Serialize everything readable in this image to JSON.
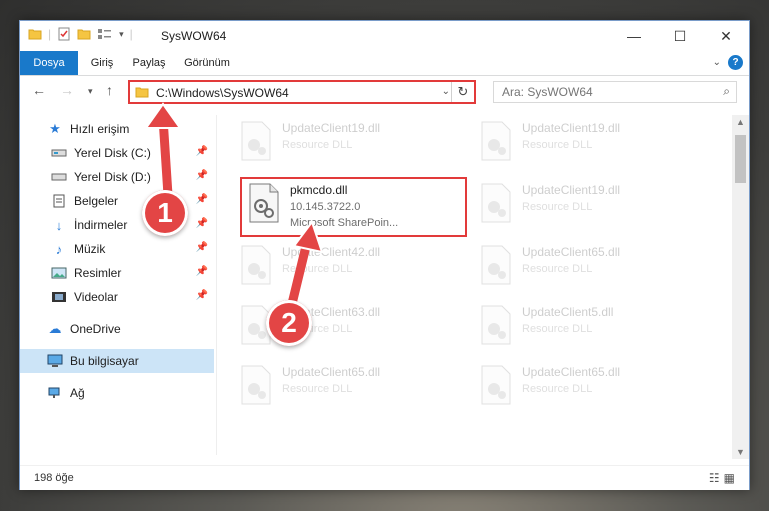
{
  "window": {
    "title": "SysWOW64",
    "controls": {
      "minimize": "—",
      "maximize": "☐",
      "close": "✕"
    }
  },
  "ribbon": {
    "tabs": [
      {
        "label": "Dosya"
      },
      {
        "label": "Giriş"
      },
      {
        "label": "Paylaş"
      },
      {
        "label": "Görünüm"
      }
    ],
    "help": "?"
  },
  "nav": {
    "address_path": "C:\\Windows\\SysWOW64",
    "search_placeholder": "Ara: SysWOW64"
  },
  "sidebar": {
    "quick_access": "Hızlı erişim",
    "items": [
      {
        "label": "Yerel Disk (C:)"
      },
      {
        "label": "Yerel Disk (D:)"
      },
      {
        "label": "Belgeler"
      },
      {
        "label": "İndirmeler"
      },
      {
        "label": "Müzik"
      },
      {
        "label": "Resimler"
      },
      {
        "label": "Videolar"
      }
    ],
    "onedrive": "OneDrive",
    "this_pc": "Bu bilgisayar",
    "network": "Ağ"
  },
  "files": {
    "highlighted": {
      "name": "pkmcdo.dll",
      "version": "10.145.3722.0",
      "description": "Microsoft SharePoin..."
    },
    "background": [
      {
        "name": "UpdateClient19.dll",
        "desc": "Resource DLL"
      },
      {
        "name": "UpdateClient19.dll",
        "desc": "Resource DLL"
      },
      {
        "name": "UpdateClient19.dll",
        "desc": "Resource DLL"
      },
      {
        "name": "UpdateClient42.dll",
        "desc": "Resource DLL"
      },
      {
        "name": "UpdateClient65.dll",
        "desc": "Resource DLL"
      },
      {
        "name": "UpdateClient63.dll",
        "desc": "Resource DLL"
      },
      {
        "name": "UpdateClient5.dll",
        "desc": "Resource DLL"
      },
      {
        "name": "UpdateClient65.dll",
        "desc": "Resource DLL"
      },
      {
        "name": "UpdateClient65.dll",
        "desc": "Resource DLL"
      }
    ]
  },
  "status": {
    "item_count": "198 öğe"
  },
  "annotations": {
    "step1": "1",
    "step2": "2"
  },
  "colors": {
    "accent": "#1979ca",
    "highlight": "#e23a3a",
    "badge": "#e34545",
    "selection": "#cce4f7"
  }
}
